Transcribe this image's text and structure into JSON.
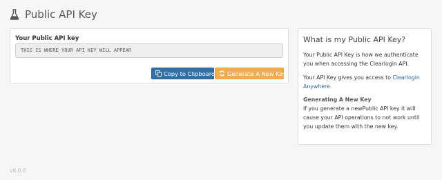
{
  "header": {
    "title": "Public API Key",
    "icon": "flask-icon"
  },
  "key_panel": {
    "label": "Your Public API key",
    "key_value": "THIS IS WHERE YOUR API KEY WILL APPEAR",
    "copy_button": {
      "label": "Copy to Clipboard",
      "icon": "copy-icon",
      "color": "#3071a9"
    },
    "generate_button": {
      "label": "Generate A New Key",
      "icon": "refresh-icon",
      "color": "#f0ad4e"
    }
  },
  "info": {
    "title": "What is my Public API Key?",
    "p1": "Your Public API Key is how we authenticate you when accessing the Clearlogin API.",
    "p2_prefix": "Your API Key gives you access to ",
    "p2_link": "Clearlogin Anywhere",
    "p2_suffix": ".",
    "subtitle": "Generating A New Key",
    "p3": "If you generate a newPublic API key it will cause your API operations to not work until you update them with the new key."
  },
  "footer": {
    "version": "v6.0.0"
  }
}
